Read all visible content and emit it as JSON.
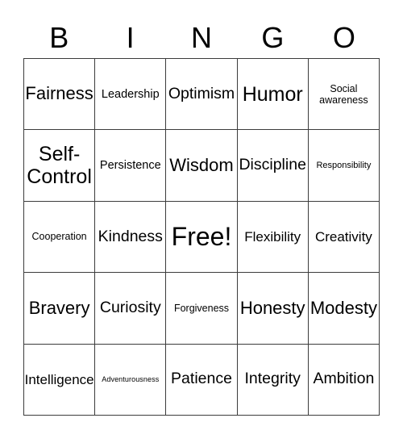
{
  "card": {
    "title": "BINGO",
    "header_letters": [
      "B",
      "I",
      "N",
      "G",
      "O"
    ],
    "columns": 5,
    "rows": 5,
    "border_color": "#3c3c3c",
    "text_color": "#000000",
    "background_color": "#ffffff",
    "free_space": {
      "label": "Free!",
      "row": 3,
      "column": 3
    },
    "cells": [
      {
        "label": "Fairness",
        "size": "fs-2xl",
        "row": 1,
        "column": 1
      },
      {
        "label": "Leadership",
        "size": "fs-m",
        "row": 1,
        "column": 2
      },
      {
        "label": "Optimism",
        "size": "fs-xl",
        "row": 1,
        "column": 3
      },
      {
        "label": "Humor",
        "size": "fs-3xl",
        "row": 1,
        "column": 4
      },
      {
        "label": "Social awareness",
        "size": "fs-s",
        "row": 1,
        "column": 5
      },
      {
        "label": "Self-Control",
        "size": "fs-3xl",
        "row": 2,
        "column": 1
      },
      {
        "label": "Persistence",
        "size": "fs-m",
        "row": 2,
        "column": 2
      },
      {
        "label": "Wisdom",
        "size": "fs-2xl",
        "row": 2,
        "column": 3
      },
      {
        "label": "Discipline",
        "size": "fs-xl",
        "row": 2,
        "column": 4
      },
      {
        "label": "Responsibility",
        "size": "fs-xs",
        "row": 2,
        "column": 5
      },
      {
        "label": "Cooperation",
        "size": "fs-s",
        "row": 3,
        "column": 1
      },
      {
        "label": "Kindness",
        "size": "fs-xl",
        "row": 3,
        "column": 2
      },
      {
        "label": "Free!",
        "size": "fs-free",
        "row": 3,
        "column": 3
      },
      {
        "label": "Flexibility",
        "size": "fs-l",
        "row": 3,
        "column": 4
      },
      {
        "label": "Creativity",
        "size": "fs-l",
        "row": 3,
        "column": 5
      },
      {
        "label": "Bravery",
        "size": "fs-2xl",
        "row": 4,
        "column": 1
      },
      {
        "label": "Curiosity",
        "size": "fs-xl",
        "row": 4,
        "column": 2
      },
      {
        "label": "Forgiveness",
        "size": "fs-s",
        "row": 4,
        "column": 3
      },
      {
        "label": "Honesty",
        "size": "fs-2xl",
        "row": 4,
        "column": 4
      },
      {
        "label": "Modesty",
        "size": "fs-2xl",
        "row": 4,
        "column": 5
      },
      {
        "label": "Intelligence",
        "size": "fs-l",
        "row": 5,
        "column": 1
      },
      {
        "label": "Adventurousness",
        "size": "fs-xxs",
        "row": 5,
        "column": 2
      },
      {
        "label": "Patience",
        "size": "fs-xl",
        "row": 5,
        "column": 3
      },
      {
        "label": "Integrity",
        "size": "fs-xl",
        "row": 5,
        "column": 4
      },
      {
        "label": "Ambition",
        "size": "fs-xl",
        "row": 5,
        "column": 5
      }
    ]
  }
}
